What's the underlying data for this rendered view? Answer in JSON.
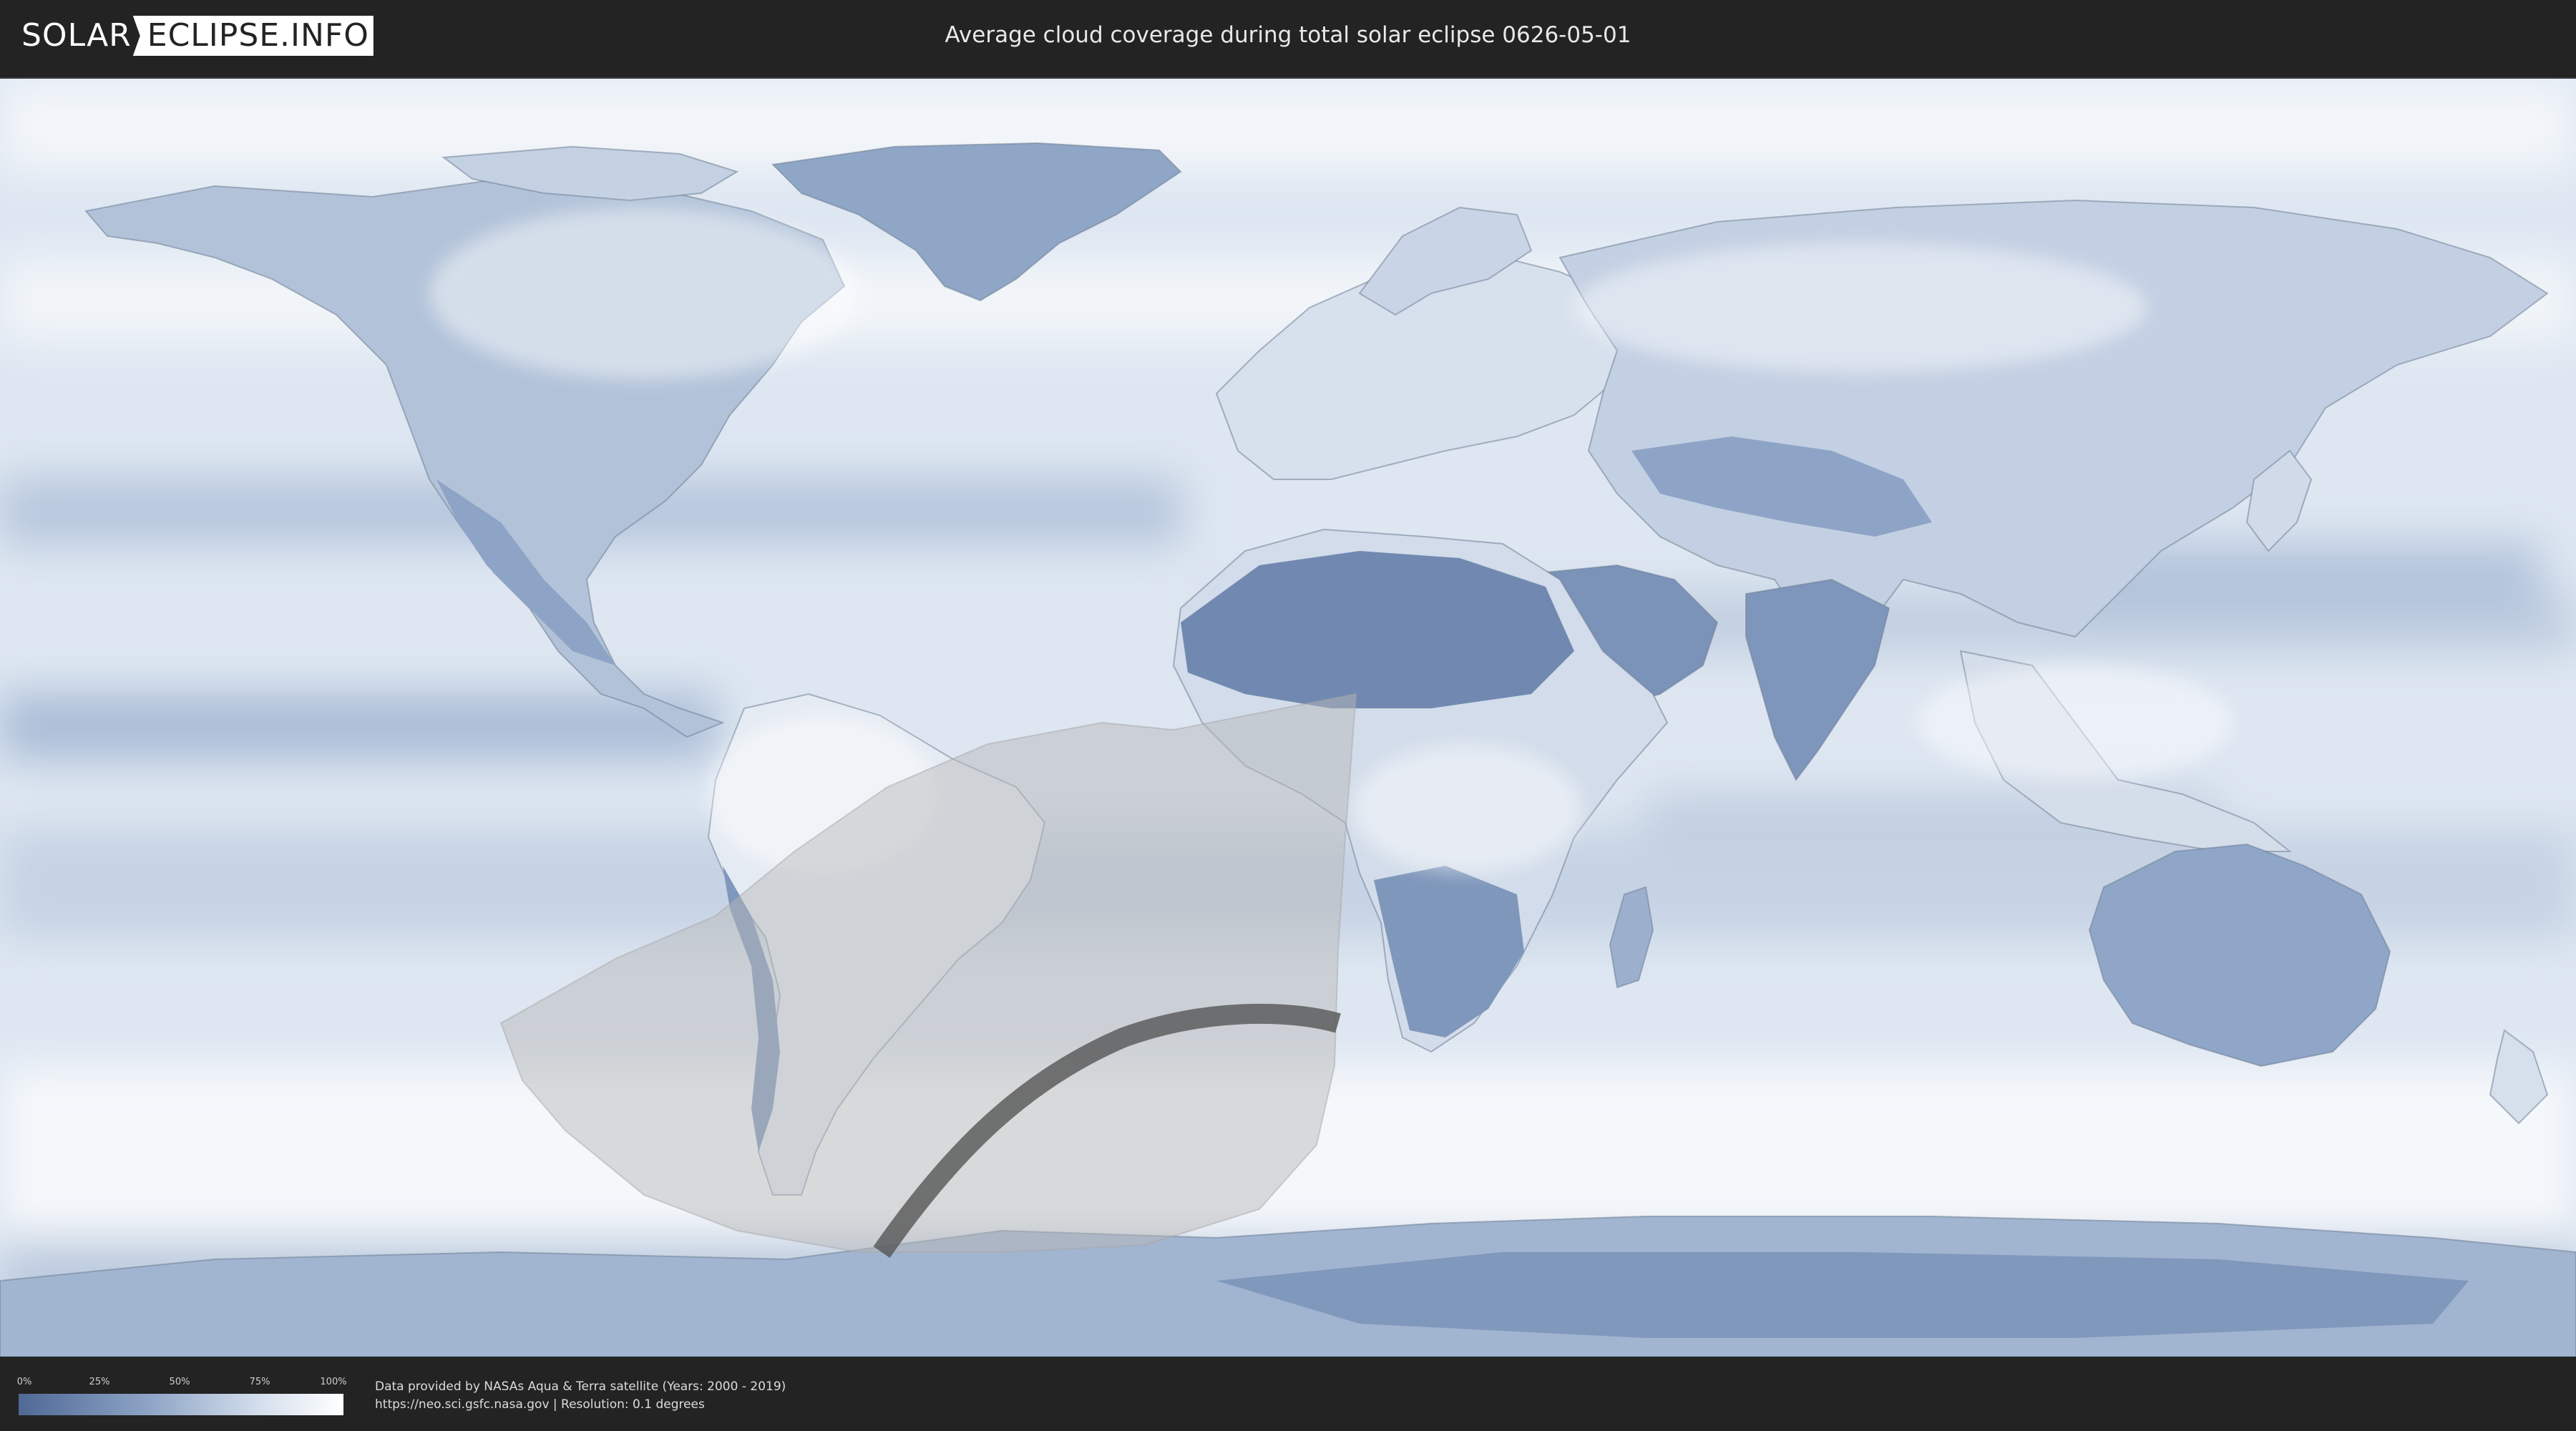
{
  "header": {
    "logo_left": "SOLAR",
    "logo_right": "ECLIPSE.INFO",
    "title": "Average cloud coverage during total solar eclipse 0626-05-01"
  },
  "legend": {
    "ticks": [
      "0%",
      "25%",
      "50%",
      "75%",
      "100%"
    ],
    "gradient_colors": [
      "#4f6996",
      "#8ea4c6",
      "#d6e0ee",
      "#ffffff"
    ]
  },
  "credits": {
    "line1": "Data provided by NASAs Aqua & Terra satellite (Years: 2000 - 2019)",
    "line2": "https://neo.sci.gsfc.nasa.gov | Resolution: 0.1 degrees"
  },
  "map": {
    "projection": "equirectangular",
    "colors": {
      "clear_sky": "#4f6996",
      "cloudy": "#ffffff",
      "eclipse_overlay": "#b8b8b8",
      "totality_path": "#555555"
    }
  }
}
